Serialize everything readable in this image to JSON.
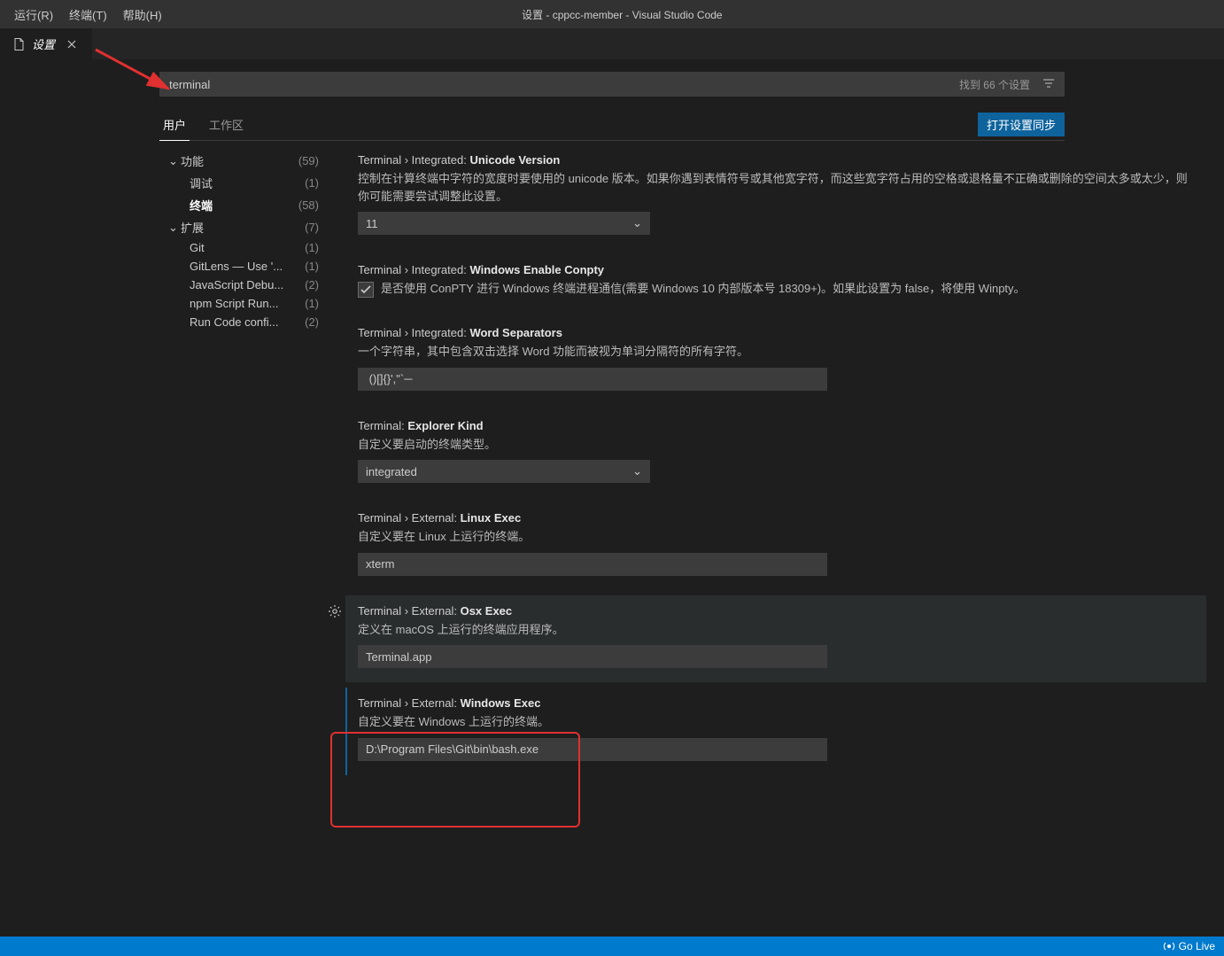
{
  "menubar": {
    "run": "运行(R)",
    "terminal": "终端(T)",
    "help": "帮助(H)"
  },
  "window_title": "设置 - cppcc-member - Visual Studio Code",
  "tab": {
    "label": "设置"
  },
  "search": {
    "value": "terminal",
    "result": "找到 66 个设置"
  },
  "scope": {
    "user": "用户",
    "workspace": "工作区",
    "sync": "打开设置同步"
  },
  "toc": {
    "features": {
      "label": "功能",
      "count": "(59)"
    },
    "debug": {
      "label": "调试",
      "count": "(1)"
    },
    "terminal_item": {
      "label": "终端",
      "count": "(58)"
    },
    "extensions": {
      "label": "扩展",
      "count": "(7)"
    },
    "git": {
      "label": "Git",
      "count": "(1)"
    },
    "gitlens": {
      "label": "GitLens — Use '...",
      "count": "(1)"
    },
    "jsdebug": {
      "label": "JavaScript Debu...",
      "count": "(2)"
    },
    "npm": {
      "label": "npm Script Run...",
      "count": "(1)"
    },
    "runcode": {
      "label": "Run Code confi...",
      "count": "(2)"
    }
  },
  "settings": {
    "unicode": {
      "prefix": "Terminal › Integrated: ",
      "name": "Unicode Version",
      "desc": "控制在计算终端中字符的宽度时要使用的 unicode 版本。如果你遇到表情符号或其他宽字符，而这些宽字符占用的空格或退格量不正确或删除的空间太多或太少，则你可能需要尝试调整此设置。",
      "value": "11"
    },
    "conpty": {
      "prefix": "Terminal › Integrated: ",
      "name": "Windows Enable Conpty",
      "desc": "是否使用 ConPTY 进行 Windows 终端进程通信(需要 Windows 10 内部版本号 18309+)。如果此设置为 false，将使用 Winpty。"
    },
    "wordsep": {
      "prefix": "Terminal › Integrated: ",
      "name": "Word Separators",
      "desc": "一个字符串，其中包含双击选择 Word 功能而被视为单词分隔符的所有字符。",
      "value": " ()[]{}',\"`─"
    },
    "explorerkind": {
      "prefix": "Terminal: ",
      "name": "Explorer Kind",
      "desc": "自定义要启动的终端类型。",
      "value": "integrated"
    },
    "linuxexec": {
      "prefix": "Terminal › External: ",
      "name": "Linux Exec",
      "desc": "自定义要在 Linux 上运行的终端。",
      "value": "xterm"
    },
    "osxexec": {
      "prefix": "Terminal › External: ",
      "name": "Osx Exec",
      "desc": "定义在 macOS 上运行的终端应用程序。",
      "value": "Terminal.app"
    },
    "winexec": {
      "prefix": "Terminal › External: ",
      "name": "Windows Exec",
      "desc": "自定义要在 Windows 上运行的终端。",
      "value": "D:\\Program Files\\Git\\bin\\bash.exe"
    }
  },
  "status": {
    "golive": "Go Live"
  }
}
